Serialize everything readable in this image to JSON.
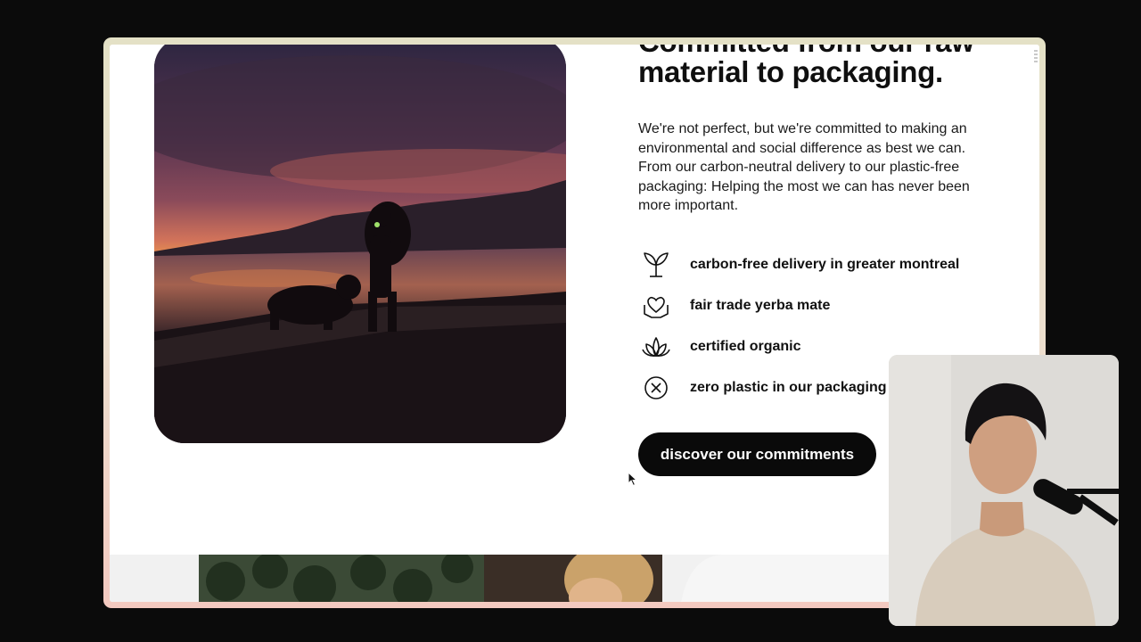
{
  "section": {
    "heading": "Committed from our raw material to packaging.",
    "body": "We're not perfect, but we're committed to making an environmental and social difference as best we can. From our carbon-neutral delivery to our plastic-free packaging: Helping the most we can has never been more important.",
    "features": [
      {
        "icon": "sprout-icon",
        "label": "carbon-free delivery in greater montreal"
      },
      {
        "icon": "heart-hands-icon",
        "label": "fair trade yerba mate"
      },
      {
        "icon": "lotus-icon",
        "label": "certified organic"
      },
      {
        "icon": "no-plastic-icon",
        "label": "zero plastic in our packaging"
      }
    ],
    "cta_label": "discover our commitments"
  },
  "colors": {
    "background": "#0b0b0b",
    "page": "#ffffff",
    "text": "#111111",
    "button": "#0a0a0a",
    "button_text": "#ffffff"
  }
}
